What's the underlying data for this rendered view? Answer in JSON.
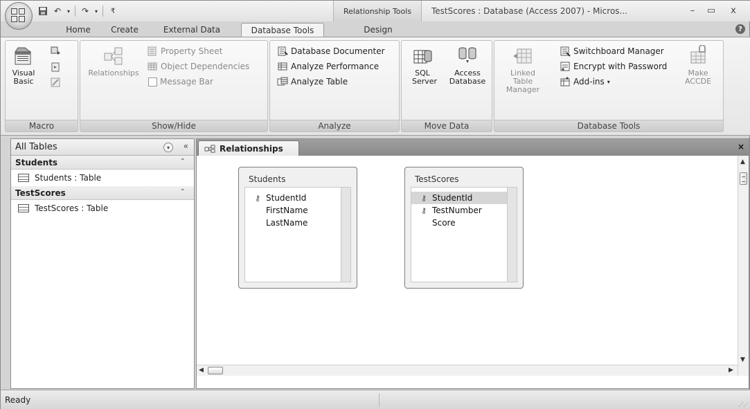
{
  "window": {
    "title": "TestScores : Database (Access 2007) - Micros...",
    "contextual_title": "Relationship Tools",
    "minimize": "–",
    "maximize": "▭",
    "close": "x"
  },
  "quick_access": {
    "save_icon": "save-icon",
    "undo_icon": "undo-icon",
    "redo_icon": "redo-icon",
    "customize_icon": "customize-qat-icon"
  },
  "tabs": [
    {
      "label": "Home"
    },
    {
      "label": "Create"
    },
    {
      "label": "External Data"
    },
    {
      "label": "Database Tools",
      "active": true
    },
    {
      "label": "Design"
    }
  ],
  "help": "?",
  "ribbon": {
    "macro": {
      "label": "Macro",
      "visual_basic": "Visual Basic"
    },
    "show_hide": {
      "label": "Show/Hide",
      "relationships": "Relationships",
      "property_sheet": "Property Sheet",
      "object_dependencies": "Object Dependencies",
      "message_bar": "Message Bar"
    },
    "analyze": {
      "label": "Analyze",
      "documenter": "Database Documenter",
      "performance": "Analyze Performance",
      "table": "Analyze Table"
    },
    "move_data": {
      "label": "Move Data",
      "sql_server": "SQL Server",
      "access_database": "Access Database"
    },
    "database_tools": {
      "label": "Database Tools",
      "linked_table_manager": "Linked Table Manager",
      "switchboard_manager": "Switchboard Manager",
      "encrypt": "Encrypt with Password",
      "addins": "Add-ins",
      "make_accde": "Make ACCDE"
    }
  },
  "nav": {
    "header": "All Tables",
    "groups": [
      {
        "name": "Students",
        "item": "Students : Table"
      },
      {
        "name": "TestScores",
        "item": "TestScores : Table"
      }
    ]
  },
  "document": {
    "tab_label": "Relationships",
    "tables": [
      {
        "title": "Students",
        "fields": [
          {
            "name": "StudentId",
            "key": true
          },
          {
            "name": "FirstName",
            "key": false
          },
          {
            "name": "LastName",
            "key": false
          }
        ]
      },
      {
        "title": "TestScores",
        "fields": [
          {
            "name": "StudentId",
            "key": true,
            "selected": true
          },
          {
            "name": "TestNumber",
            "key": true
          },
          {
            "name": "Score",
            "key": false
          }
        ]
      }
    ]
  },
  "status": {
    "text": "Ready"
  }
}
